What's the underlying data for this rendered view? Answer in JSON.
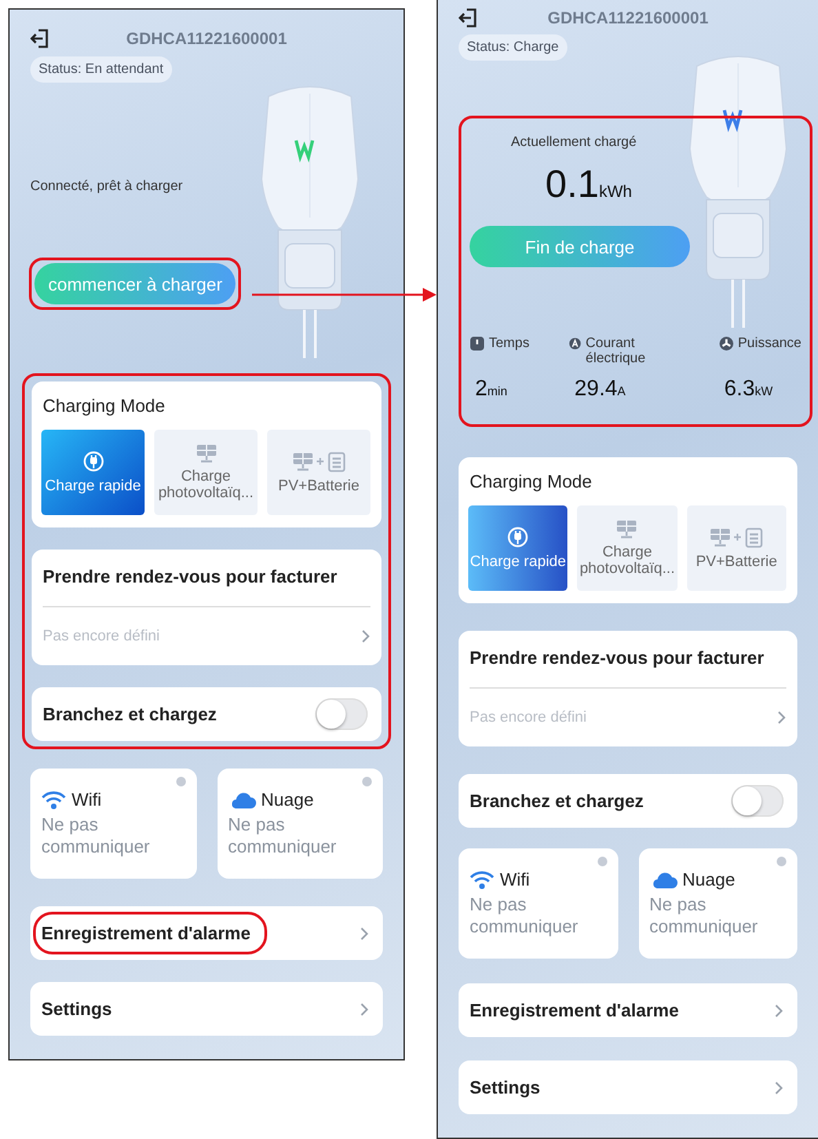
{
  "screens": [
    {
      "kind": "idle",
      "device_id": "GDHCA11221600001",
      "status": "Status: En attendant",
      "message": "Connecté, prêt à charger",
      "action_button": {
        "label": "commencer à charger",
        "highlighted": true
      },
      "options_highlighted": true,
      "charging_mode": {
        "title": "Charging Mode",
        "modes": [
          {
            "kind": "plug",
            "label": "Charge rapide",
            "selected": true
          },
          {
            "kind": "solar",
            "label": "Charge photovoltaïq...",
            "selected": false
          },
          {
            "kind": "solar_battery",
            "label": "PV+Batterie",
            "selected": false
          }
        ]
      },
      "appointment": {
        "title": "Prendre rendez-vous pour facturer",
        "value": "Pas encore défini"
      },
      "plug_and_charge": {
        "label": "Branchez et chargez",
        "on": false
      },
      "connections": [
        {
          "kind": "wifi",
          "label": "Wifi",
          "status": "Ne pas communiquer"
        },
        {
          "kind": "cloud",
          "label": "Nuage",
          "status": "Ne pas communiquer"
        }
      ],
      "menu": [
        {
          "label": "Enregistrement d'alarme",
          "highlighted": true
        },
        {
          "label": "Settings",
          "highlighted": false
        }
      ]
    },
    {
      "kind": "charging",
      "device_id": "GDHCA11221600001",
      "status": "Status: Charge",
      "energy": {
        "label": "Actuellement chargé",
        "value": "0.1",
        "unit": "kWh"
      },
      "action_button": {
        "label": "Fin de charge",
        "highlighted": false
      },
      "stats_highlighted": true,
      "stats": [
        {
          "kind": "time",
          "label": "Temps",
          "value": "2",
          "unit": "min"
        },
        {
          "kind": "current",
          "label": "Courant électrique",
          "value": "29.4",
          "unit": "A"
        },
        {
          "kind": "power",
          "label": "Puissance",
          "value": "6.3",
          "unit": "kW"
        }
      ],
      "options_highlighted": false,
      "charging_mode": {
        "title": "Charging Mode",
        "modes": [
          {
            "kind": "plug",
            "label": "Charge rapide",
            "selected": true
          },
          {
            "kind": "solar",
            "label": "Charge photovoltaïq...",
            "selected": false
          },
          {
            "kind": "solar_battery",
            "label": "PV+Batterie",
            "selected": false
          }
        ]
      },
      "appointment": {
        "title": "Prendre rendez-vous pour facturer",
        "value": "Pas encore défini"
      },
      "plug_and_charge": {
        "label": "Branchez et chargez",
        "on": false
      },
      "connections": [
        {
          "kind": "wifi",
          "label": "Wifi",
          "status": "Ne pas communiquer"
        },
        {
          "kind": "cloud",
          "label": "Nuage",
          "status": "Ne pas communiquer"
        }
      ],
      "menu": [
        {
          "label": "Enregistrement d'alarme",
          "highlighted": false
        },
        {
          "label": "Settings",
          "highlighted": false
        }
      ]
    }
  ]
}
